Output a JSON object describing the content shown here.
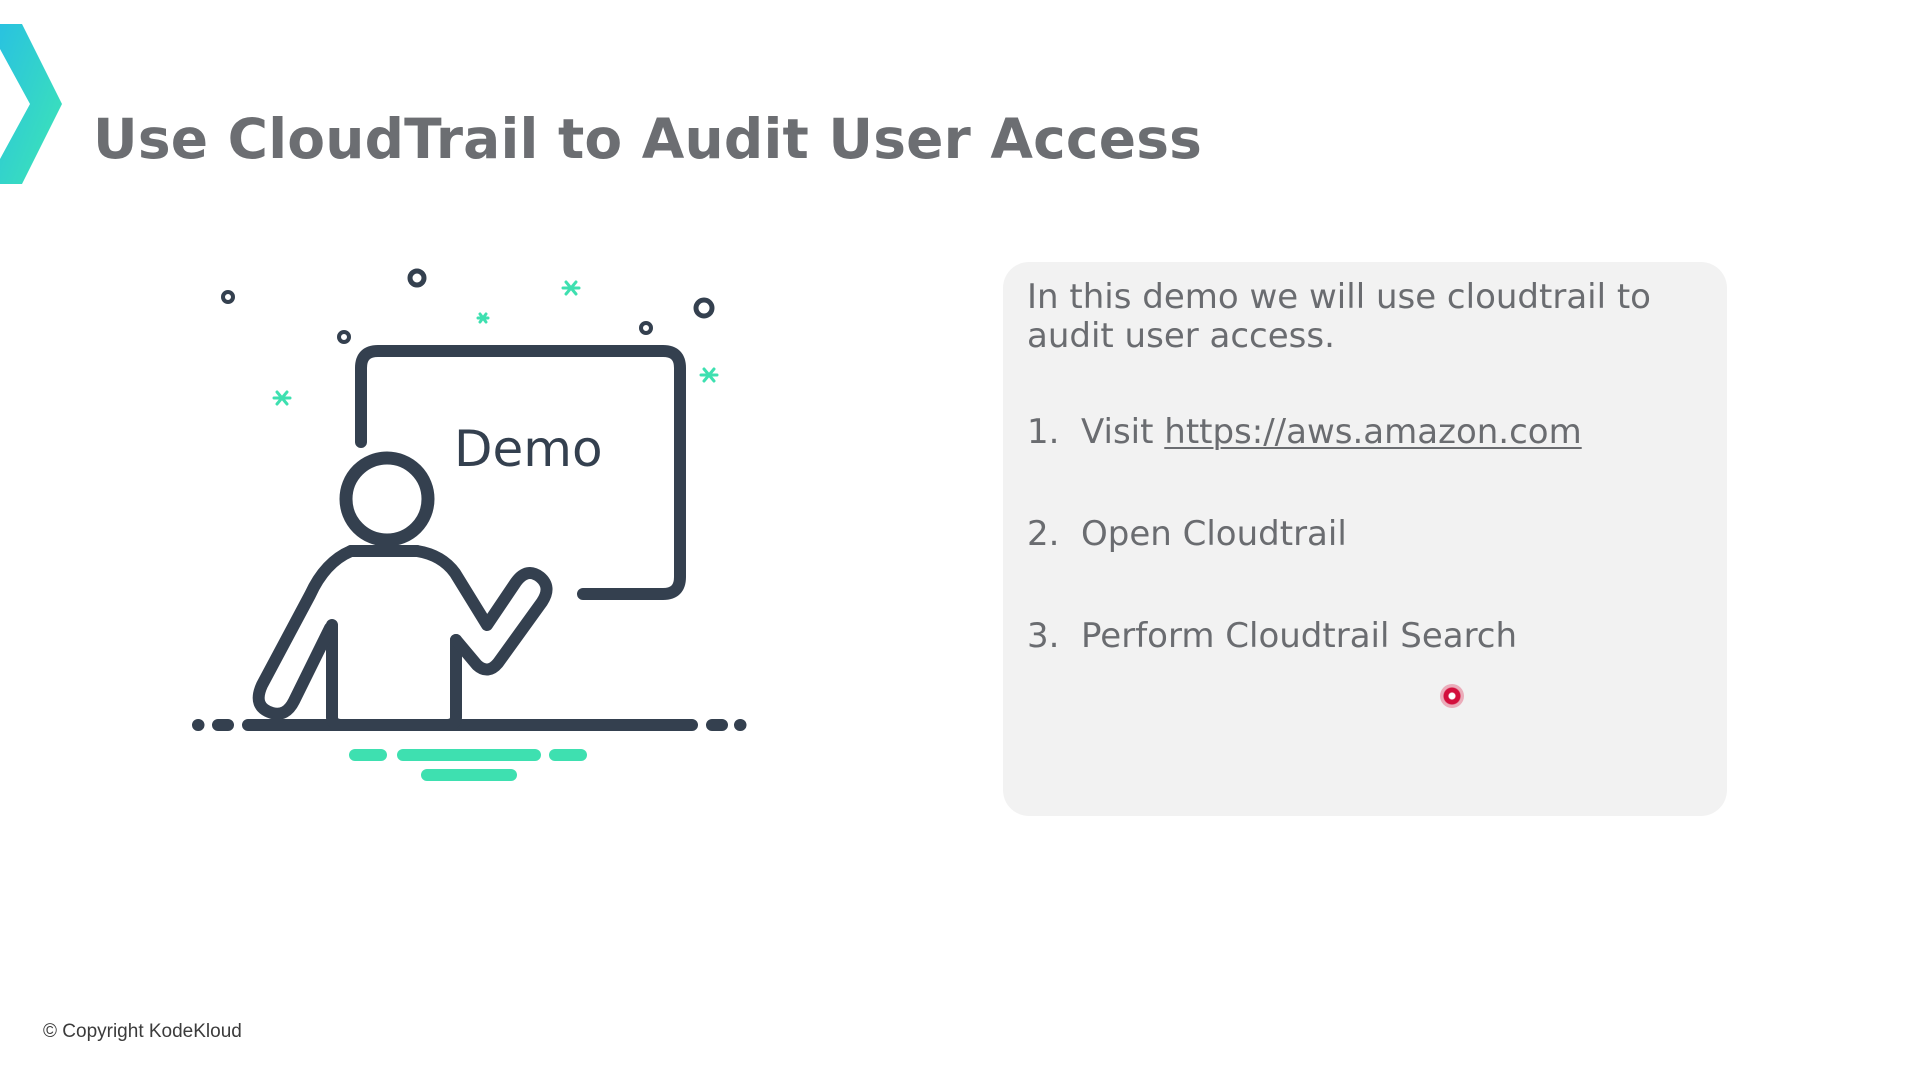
{
  "slide": {
    "title": "Use CloudTrail to Audit User Access"
  },
  "illustration": {
    "board_label": "Demo",
    "icon": "presenter-at-whiteboard-icon"
  },
  "card": {
    "intro": "In this demo we will use cloudtrail to audit user access.",
    "steps": [
      {
        "number": "1.",
        "prefix": "Visit ",
        "link": "https://aws.amazon.com"
      },
      {
        "number": "2.",
        "text": "Open Cloudtrail"
      },
      {
        "number": "3.",
        "text": "Perform Cloudtrail Search"
      }
    ]
  },
  "footer": {
    "copyright": "© Copyright KodeKloud"
  },
  "colors": {
    "accent": "#3ee0b0",
    "icon_stroke": "#34404f",
    "title_text": "#6c6e72",
    "card_background": "#f2f2f2",
    "cursor": "#d30f3c"
  }
}
